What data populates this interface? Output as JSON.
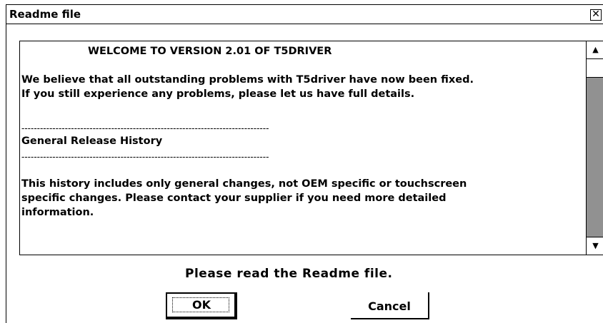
{
  "window": {
    "title": "Readme file",
    "close_glyph": "✕"
  },
  "readme": {
    "heading": "WELCOME TO VERSION 2.01 OF T5DRIVER",
    "para1_line1": "We believe that all outstanding problems with T5driver have now been fixed.",
    "para1_line2": "If you still experience any problems, please let us have full details.",
    "separator": "--------------------------------------------------------------------------------",
    "section_title": "General Release History",
    "para2_line1": "This history includes only general changes, not OEM specific or touchscreen",
    "para2_line2": "specific changes. Please contact your supplier if you need more detailed",
    "para2_line3": "information."
  },
  "scrollbar": {
    "up_glyph": "▲",
    "down_glyph": "▼"
  },
  "prompt": "Please read the Readme file.",
  "buttons": {
    "ok": "OK",
    "cancel": "Cancel"
  }
}
